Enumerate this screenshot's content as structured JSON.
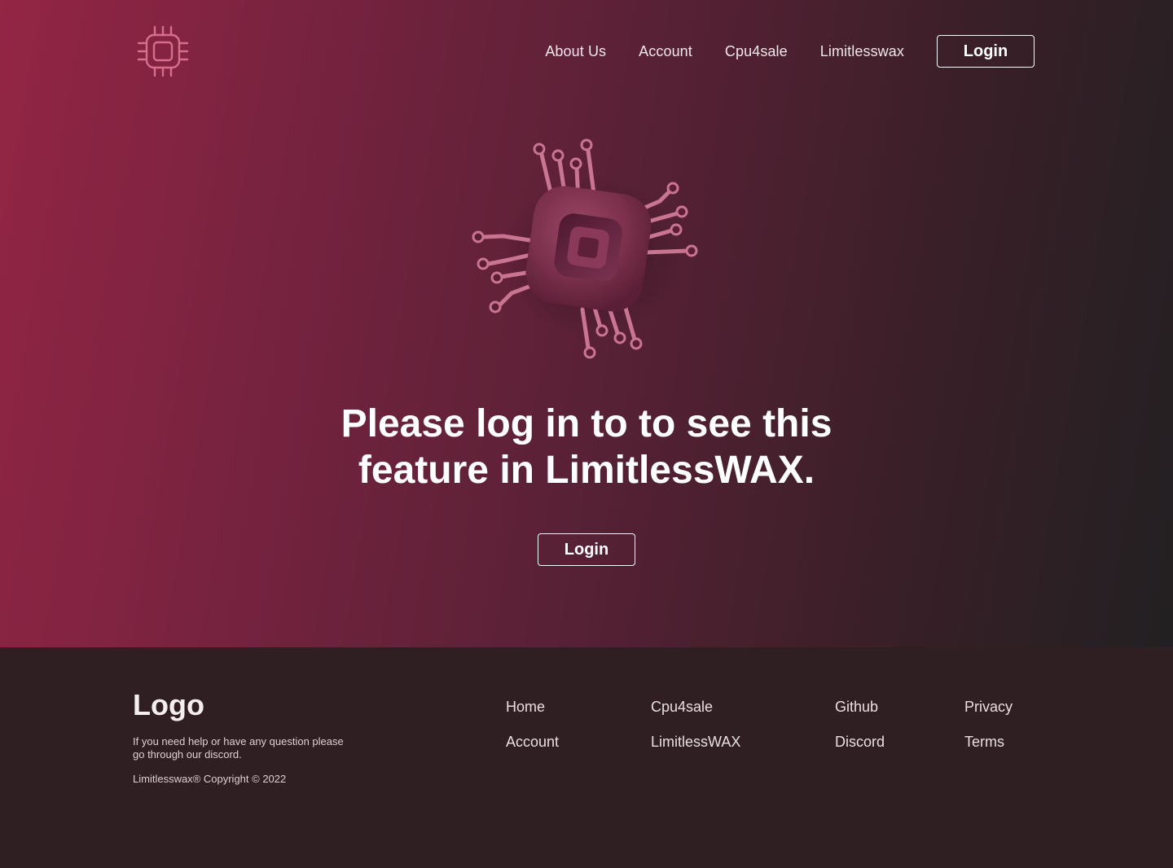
{
  "header": {
    "logo_icon": "cpu-chip-icon",
    "nav": [
      "About Us",
      "Account",
      "Cpu4sale",
      "Limitlesswax"
    ],
    "login_label": "Login"
  },
  "hero": {
    "illustration_icon": "cpu-chip-3d-icon",
    "headline_line1": "Please log in to to see this",
    "headline_line2": "feature in LimitlessWAX.",
    "login_label": "Login"
  },
  "footer": {
    "logo": "Logo",
    "help_text": "If you need help or have any question please go through our discord.",
    "copyright": "Limitlesswax® Copyright © 2022",
    "columns": [
      [
        "Home",
        "Account"
      ],
      [
        "Cpu4sale",
        "LimitlessWAX"
      ],
      [
        "Github",
        "Discord"
      ],
      [
        "Privacy",
        "Terms"
      ]
    ]
  },
  "colors": {
    "gradient_start": "#932545",
    "gradient_end": "#222022",
    "footer_bg": "#2f1f22",
    "chip_accent": "#d27a95"
  }
}
